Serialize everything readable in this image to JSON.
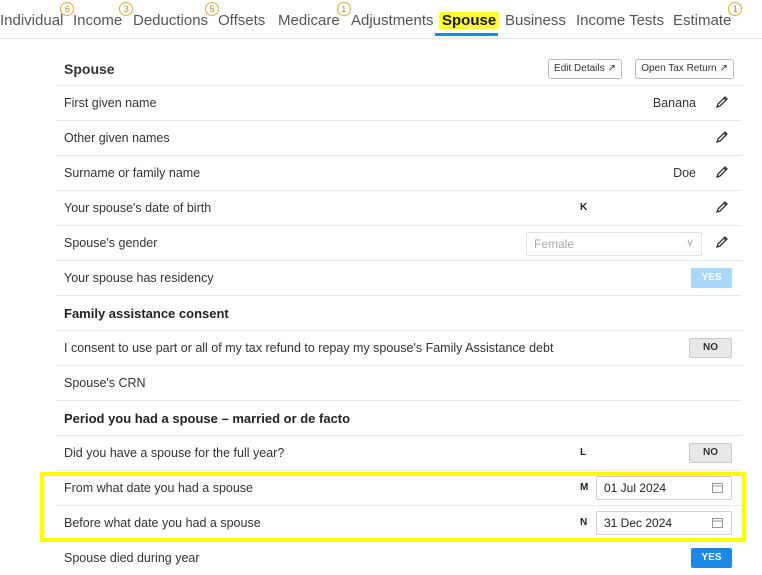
{
  "tabs": [
    {
      "label": "Individual",
      "badge": "6"
    },
    {
      "label": "Income",
      "badge": "3"
    },
    {
      "label": "Deductions",
      "badge": "5"
    },
    {
      "label": "Offsets",
      "badge": ""
    },
    {
      "label": "Medicare",
      "badge": "1"
    },
    {
      "label": "Adjustments",
      "badge": ""
    },
    {
      "label": "Spouse",
      "badge": ""
    },
    {
      "label": "Business",
      "badge": ""
    },
    {
      "label": "Income Tests",
      "badge": ""
    },
    {
      "label": "Estimate",
      "badge": "1"
    }
  ],
  "active_tab": "Spouse",
  "card": {
    "title": "Spouse",
    "edit_details": "Edit Details",
    "open_tax_return": "Open Tax Return"
  },
  "fields": {
    "first_name_label": "First given name",
    "first_name_value": "Banana",
    "other_names_label": "Other given names",
    "surname_label": "Surname or family name",
    "surname_value": "Doe",
    "dob_label": "Your spouse's date of birth",
    "dob_code": "K",
    "gender_label": "Spouse's gender",
    "gender_value": "Female",
    "residency_label": "Your spouse has residency",
    "residency_value": "YES",
    "family_section": "Family assistance consent",
    "consent_label": "I consent to use part or all of my tax refund to repay my spouse's Family Assistance debt",
    "consent_value": "NO",
    "crn_label": "Spouse's CRN",
    "period_section": "Period you had a spouse – married or de facto",
    "full_year_label": "Did you have a spouse for the full year?",
    "full_year_code": "L",
    "full_year_value": "NO",
    "from_label": "From what date you had a spouse",
    "from_code": "M",
    "from_value": "01 Jul 2024",
    "before_label": "Before what date you had a spouse",
    "before_code": "N",
    "before_value": "31 Dec 2024",
    "died_label": "Spouse died during year",
    "died_value": "YES"
  },
  "colors": {
    "accent": "#1e88e5",
    "highlight": "#ffff00",
    "badge": "#d8b23a"
  }
}
